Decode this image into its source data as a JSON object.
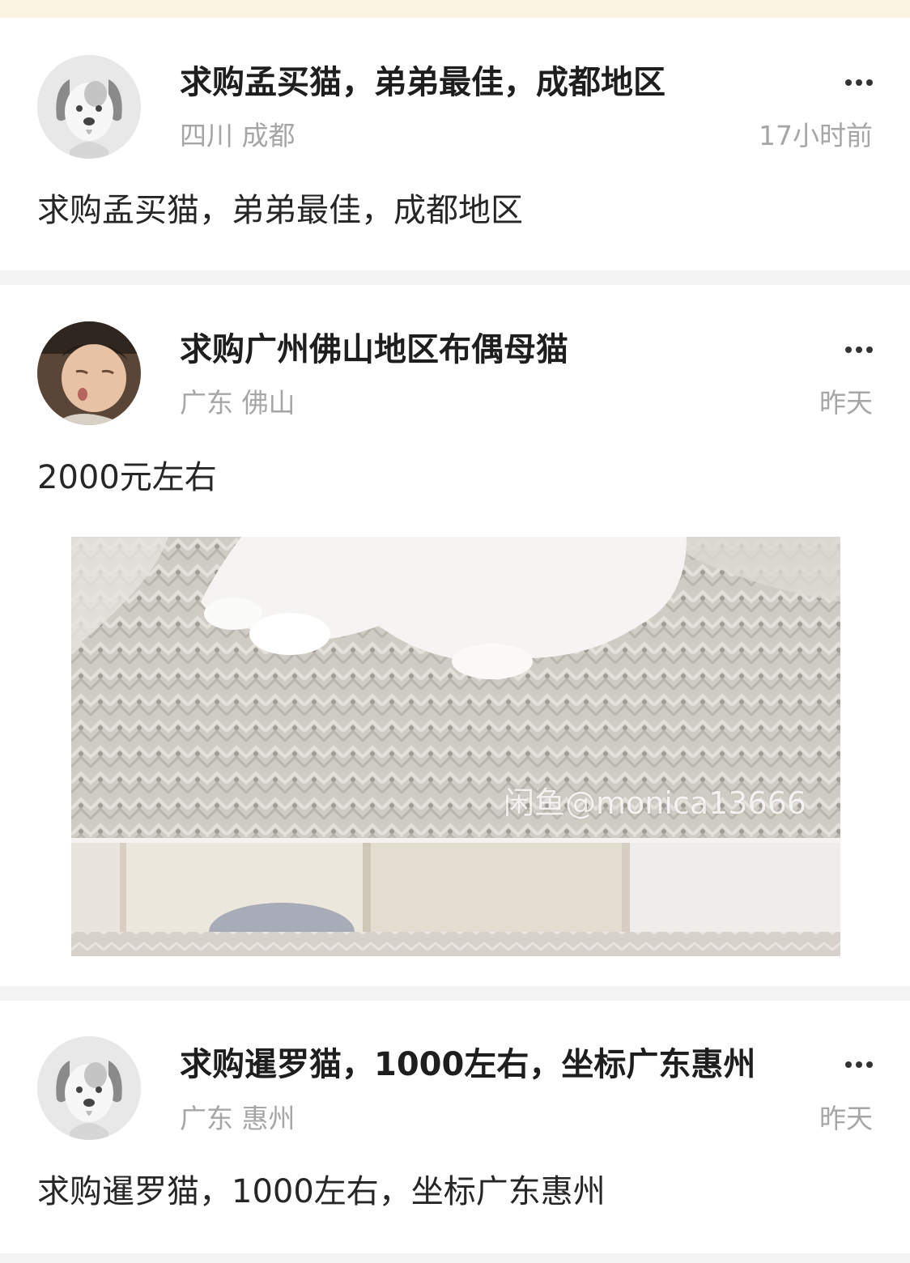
{
  "posts": [
    {
      "avatar": "dog-placeholder-avatar",
      "title": "求购孟买猫，弟弟最佳，成都地区",
      "location": "四川 成都",
      "time": "17小时前",
      "body": "求购孟买猫，弟弟最佳，成都地区"
    },
    {
      "avatar": "child-photo-avatar",
      "title": "求购广州佛山地区布偶母猫",
      "location": "广东 佛山",
      "time": "昨天",
      "body": "2000元左右",
      "image_watermark": "闲鱼@monica13666"
    },
    {
      "avatar": "dog-placeholder-avatar",
      "title": "求购暹罗猫，1000左右，坐标广东惠州",
      "location": "广东 惠州",
      "time": "昨天",
      "body": "求购暹罗猫，1000左右，坐标广东惠州"
    }
  ],
  "icons": {
    "more": "more-dots-icon"
  }
}
